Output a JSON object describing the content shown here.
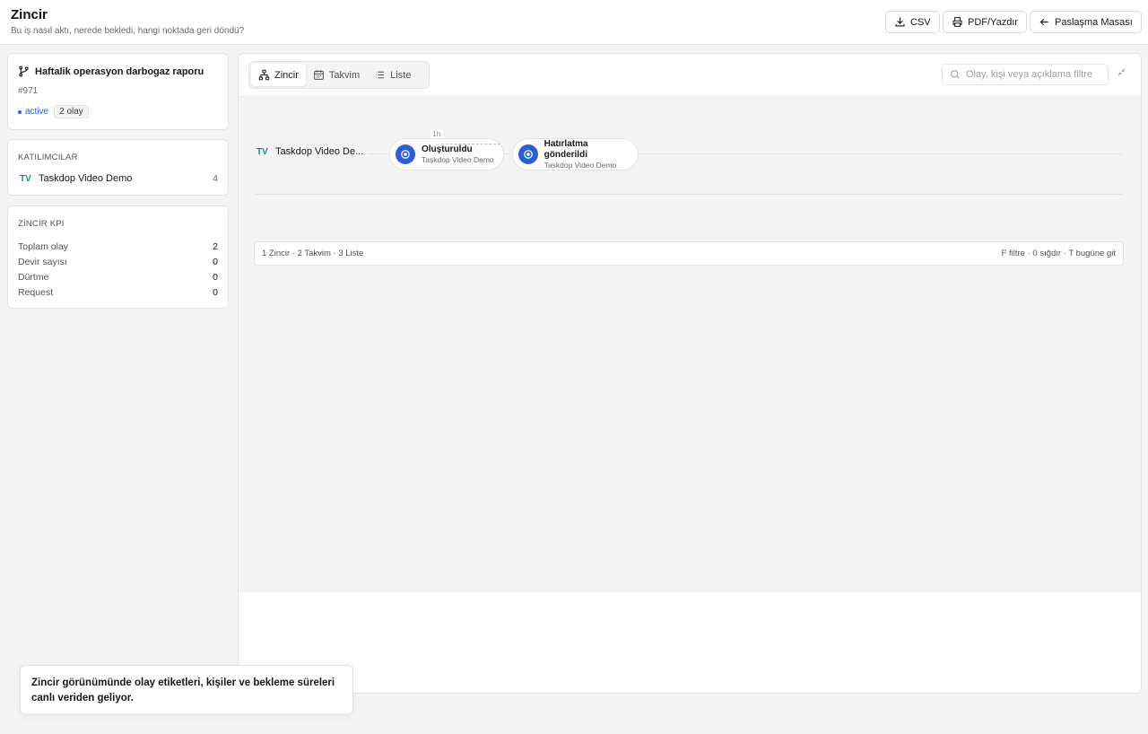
{
  "header": {
    "title": "Zincir",
    "subtitle": "Bu iş nasıl aktı, nerede bekledi, hangi noktada geri döndü?",
    "csv_label": "CSV",
    "pdf_label": "PDF/Yazdır",
    "back_label": "Paslaşma Masası"
  },
  "thread": {
    "title": "Haftalik operasyon darbogaz raporu",
    "id": "#971",
    "status": "active",
    "event_count": "2 olay"
  },
  "participants": {
    "heading": "KATILIMCILAR",
    "items": [
      {
        "initials": "TV",
        "name": "Taskdop Video Demo",
        "count": "4"
      }
    ]
  },
  "kpi": {
    "heading": "ZİNCİR KPI",
    "items": [
      {
        "label": "Toplam olay",
        "value": "2"
      },
      {
        "label": "Devir sayısı",
        "value": "0"
      },
      {
        "label": "Dürtme",
        "value": "0"
      },
      {
        "label": "Request",
        "value": "0"
      }
    ]
  },
  "tabs": [
    {
      "label": "Zincir",
      "icon": "chain-icon"
    },
    {
      "label": "Takvim",
      "icon": "calendar-icon"
    },
    {
      "label": "Liste",
      "icon": "list-icon"
    }
  ],
  "search": {
    "placeholder": "Olay, kişi veya açıklama filtre"
  },
  "lane": {
    "initials": "TV",
    "name": "Taskdop Video De...",
    "wait": "1h",
    "events": [
      {
        "title": "Oluşturuldu",
        "person": "Taskdop Video Demo"
      },
      {
        "title": "Hatırlatma gönderildi",
        "person": "Taskdop Video Demo"
      }
    ]
  },
  "footer": {
    "shortcuts_left": "1 Zincir · 2 Takvim · 3 Liste",
    "shortcuts_right": "F filtre · 0 sığdır · T bugüne git"
  },
  "toast": {
    "message": "Zincir görünümünde olay etiketleri, kişiler ve bekleme süreleri canlı veriden geliyor."
  },
  "colors": {
    "accent": "#2d5fd3",
    "status_active": "#2563eb",
    "initials": "#0d9488"
  }
}
